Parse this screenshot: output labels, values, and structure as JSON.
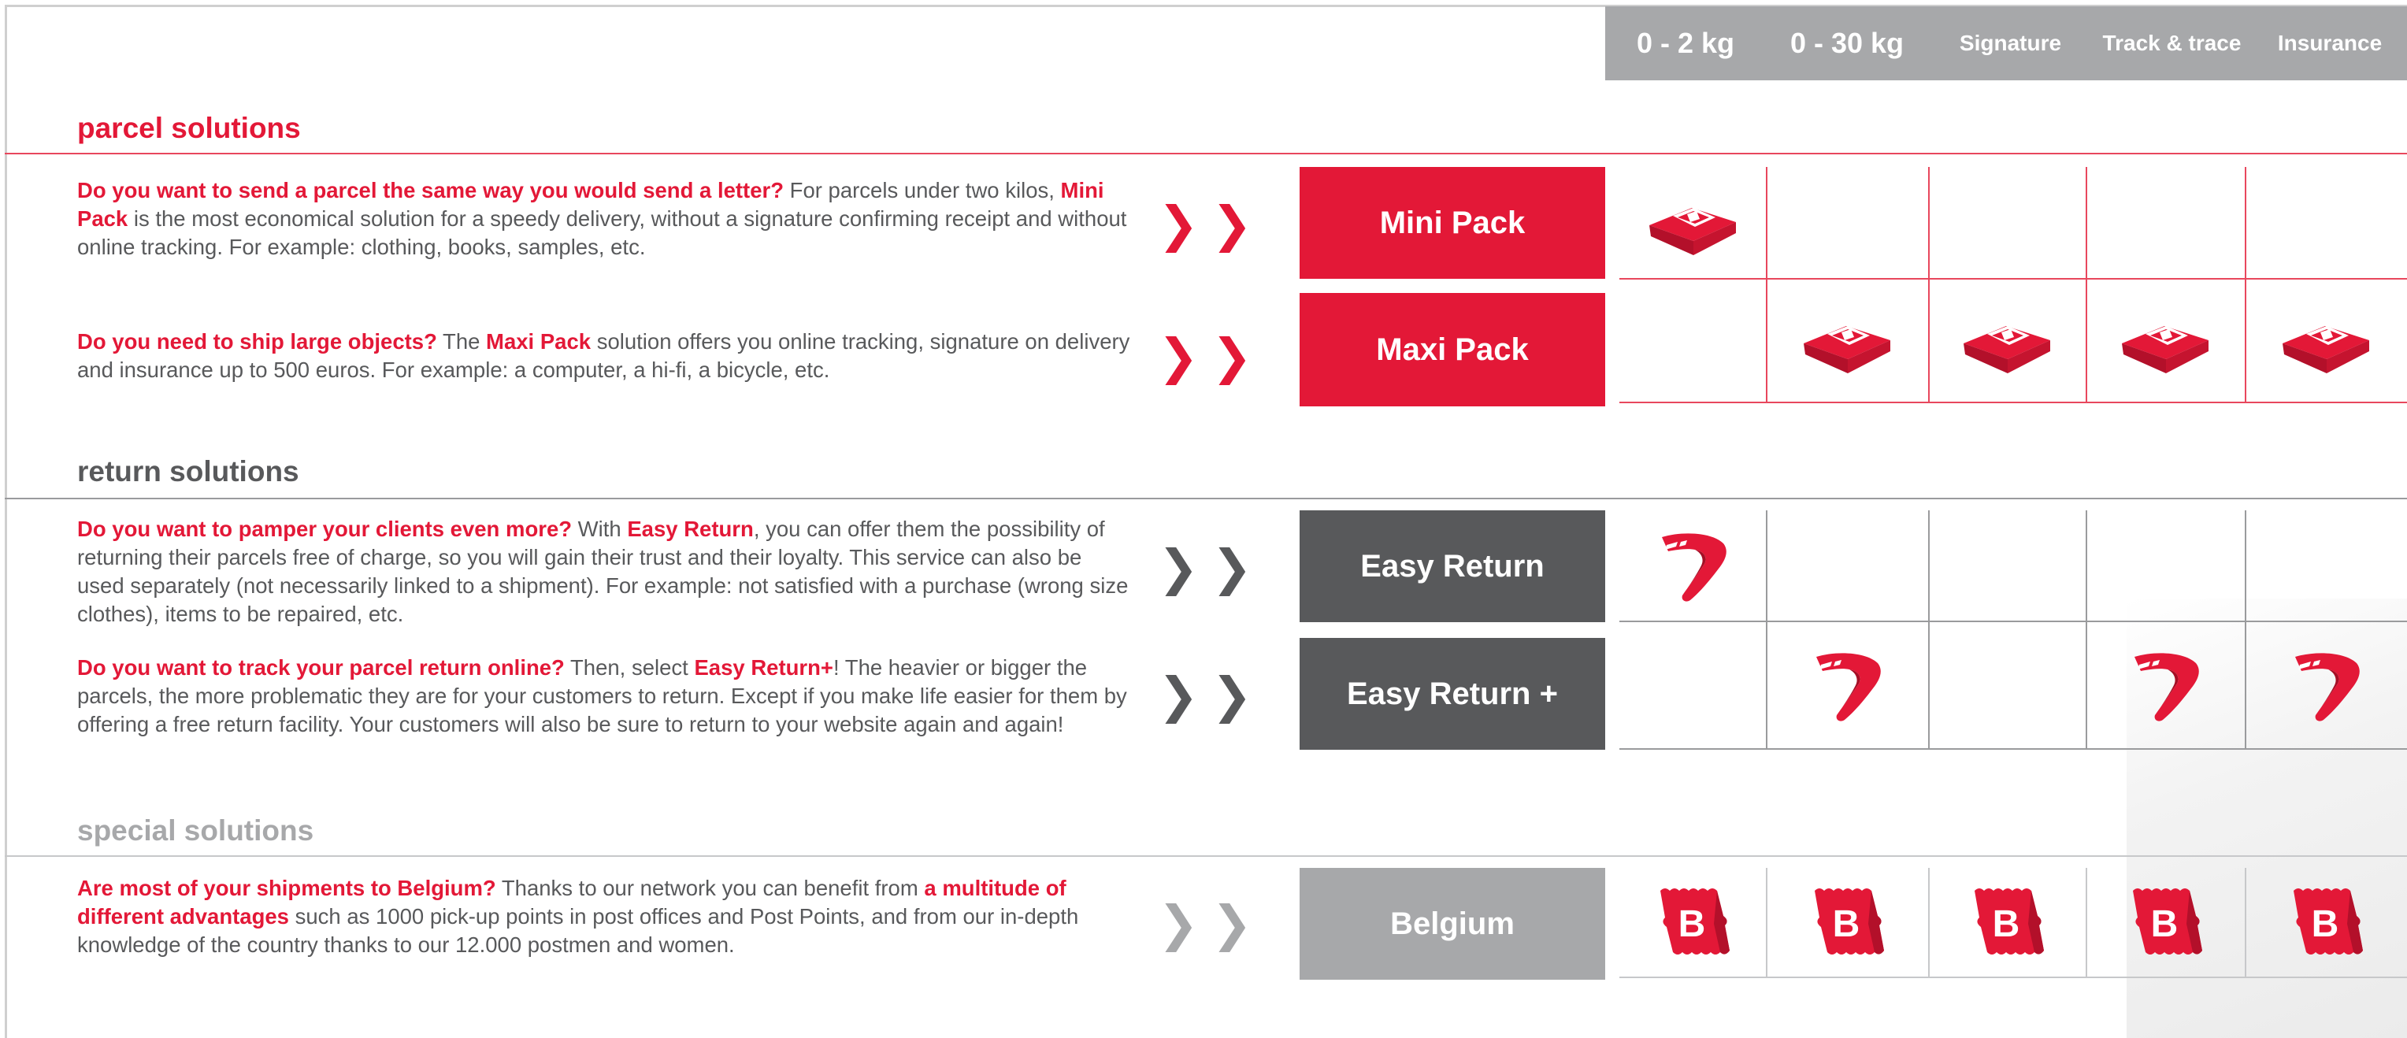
{
  "colors": {
    "red": "#e31837",
    "dark": "#58595b",
    "grey": "#a7a8aa",
    "line_red": "#e8475d",
    "line_dark": "#9a9b9d",
    "line_grey": "#c7c8ca"
  },
  "columns": [
    "0 - 2 kg",
    "0 - 30 kg",
    "Signature",
    "Track & trace",
    "Insurance"
  ],
  "sections": [
    {
      "title": "parcel solutions",
      "color": "#e31837",
      "rows": [
        {
          "product": "Mini Pack",
          "segments": [
            {
              "text": "Do you want to send a parcel the same way you would send a letter?",
              "style": "bold-red"
            },
            {
              "text": " For parcels under two kilos, ",
              "style": "plain"
            },
            {
              "text": "Mini Pack",
              "style": "bold-red"
            },
            {
              "text": " is the most economical solution for a speedy delivery, without a signature confirming receipt and without online tracking. For example: clothing, books, samples, etc.",
              "style": "plain"
            }
          ],
          "icon": "parcel-icon",
          "marks": [
            true,
            false,
            false,
            false,
            false
          ]
        },
        {
          "product": "Maxi Pack",
          "segments": [
            {
              "text": "Do you need to ship large objects?",
              "style": "bold-red"
            },
            {
              "text": " The ",
              "style": "plain"
            },
            {
              "text": "Maxi Pack",
              "style": "bold-red"
            },
            {
              "text": " solution offers you online tracking, signature on delivery and insurance up to 500 euros. For example: a computer, a hi-fi, a bicycle, etc.",
              "style": "plain"
            }
          ],
          "icon": "parcel-icon",
          "marks": [
            false,
            true,
            true,
            true,
            true
          ]
        }
      ]
    },
    {
      "title": "return solutions",
      "color": "#58595b",
      "rows": [
        {
          "product": "Easy Return",
          "segments": [
            {
              "text": "Do you want to pamper your clients even more?",
              "style": "bold-red"
            },
            {
              "text": " With ",
              "style": "plain"
            },
            {
              "text": "Easy Return",
              "style": "bold-red"
            },
            {
              "text": ", you can offer them the possibility of returning their parcels free of charge, so you will gain their trust and their loyalty. This service can also be used separately (not necessarily linked to a shipment). For example: not satisfied with a purchase (wrong size clothes), items to be repaired, etc.",
              "style": "plain"
            }
          ],
          "icon": "boomerang-icon",
          "marks": [
            true,
            false,
            false,
            false,
            false
          ]
        },
        {
          "product": "Easy Return +",
          "segments": [
            {
              "text": "Do you want to track your parcel return online?",
              "style": "bold-red"
            },
            {
              "text": " Then, select ",
              "style": "plain"
            },
            {
              "text": "Easy Return+",
              "style": "bold-red"
            },
            {
              "text": "! The heavier or bigger the parcels, the more problematic they are for your customers to return. Except if you make life easier for them by offering a free return facility. Your customers will also be sure to return to your website again and again!",
              "style": "plain"
            }
          ],
          "icon": "boomerang-icon",
          "marks": [
            false,
            true,
            false,
            true,
            true
          ]
        }
      ]
    },
    {
      "title": "special solutions",
      "color": "#a7a8aa",
      "rows": [
        {
          "product": "Belgium",
          "segments": [
            {
              "text": "Are most of your shipments to Belgium?",
              "style": "bold-red"
            },
            {
              "text": " Thanks to our network you can benefit from ",
              "style": "plain"
            },
            {
              "text": "a multitude of different advantages",
              "style": "bold-red"
            },
            {
              "text": " such as 1000 pick-up points in post offices and Post Points, and from our in-depth knowledge of the country thanks to our 12.000 postmen and women.",
              "style": "plain"
            }
          ],
          "icon": "belgium-stamp-icon",
          "stamp_letter": "B",
          "marks": [
            true,
            true,
            true,
            true,
            true
          ]
        }
      ]
    }
  ]
}
